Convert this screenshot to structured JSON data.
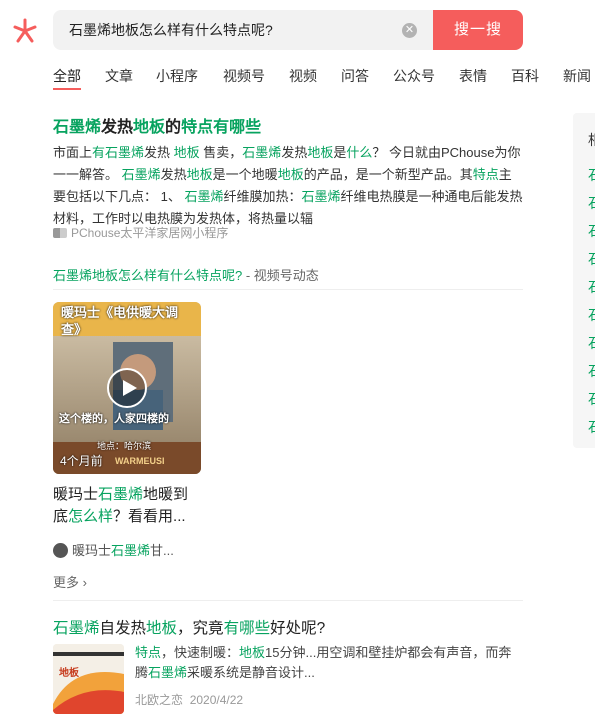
{
  "colors": {
    "accent": "#f55d5c",
    "highlight": "#07a35f",
    "text": "#222222",
    "muted": "#999999"
  },
  "search": {
    "query": "石墨烯地板怎么样有什么特点呢?",
    "button_label": "搜一搜"
  },
  "tabs": [
    "全部",
    "文章",
    "小程序",
    "视频号",
    "视频",
    "问答",
    "公众号",
    "表情",
    "百科",
    "新闻"
  ],
  "sidebar": {
    "title": "相",
    "items": [
      "石",
      "石",
      "石",
      "石",
      "石",
      "石",
      "石",
      "石",
      "石",
      "石"
    ]
  },
  "result1": {
    "title_parts": [
      "石墨烯",
      "发热",
      "地板",
      "的",
      "特点有哪些"
    ],
    "snippet_parts": [
      "市面上",
      "有石墨烯",
      "发热 ",
      "地板",
      " 售卖，",
      "石墨烯",
      "发热",
      "地板",
      "是",
      "什么",
      "？ 今日就由PChouse为你一一解答。 ",
      "石墨烯",
      "发热",
      "地板",
      "是一个地暖",
      "地板",
      "的产品，是一个新型产品。其",
      "特点",
      "主要包括以下几点： 1、 ",
      "石墨烯",
      "纤维膜加热：",
      "石墨烯",
      "纤维电热膜是一种通电后能发热材料，工作时以电热膜为发热体，将热量以辐"
    ],
    "source": "PChouse太平洋家居网小程序"
  },
  "video_section": {
    "header_query": "石墨烯地板怎么样有什么特点呢?",
    "header_suffix": " - 视频号动态",
    "thumb_title": "暖玛士《电供暖大调查》",
    "thumb_caption": "这个楼的，人家四楼的",
    "thumb_location": "地点：哈尔滨",
    "thumb_brand": "WARMEUSI",
    "time_ago": "4个月前",
    "title_parts": [
      "暖玛士",
      "石墨烯",
      "地暖到底",
      "怎么样",
      "？看看用..."
    ],
    "author_parts": [
      "暖玛士",
      "石墨烯",
      "甘..."
    ],
    "more_label": "更多",
    "more_arrow": "›"
  },
  "result3": {
    "title_parts": [
      "石墨烯",
      "自发热",
      "地板",
      "，究竟",
      "有哪些",
      "好处呢?"
    ],
    "snippet_parts": [
      "特点",
      "，快速制暖：",
      "地板",
      "15分钟...用空调和壁挂炉都会有声音，而奔腾",
      "石墨烯",
      "采暖系统是静音设计..."
    ],
    "source": "北欧之恋",
    "date": "2020/4/22",
    "thumb_text": "地板"
  }
}
